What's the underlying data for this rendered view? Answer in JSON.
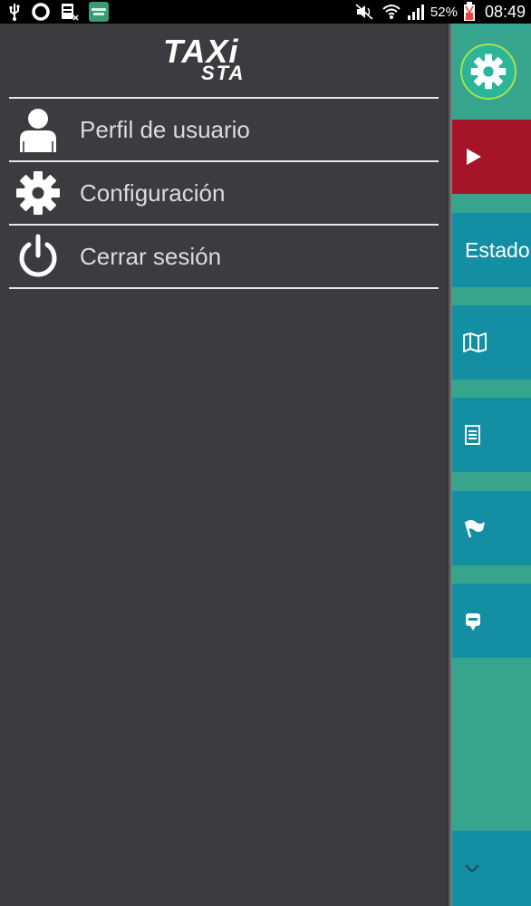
{
  "status_bar": {
    "battery_percent": "52%",
    "time": "08:49",
    "icons": [
      "usb-icon",
      "circle-icon",
      "sim-notification-icon",
      "taxista-app-icon",
      "mute-icon",
      "wifi-icon",
      "signal-icon",
      "battery-icon"
    ]
  },
  "drawer": {
    "logo": {
      "top": "TAXi",
      "bottom": "STA"
    },
    "menu": [
      {
        "label": "Perfil de usuario",
        "icon": "user-icon"
      },
      {
        "label": "Configuración",
        "icon": "gear-icon"
      },
      {
        "label": "Cerrar sesión",
        "icon": "power-icon"
      }
    ]
  },
  "rail": {
    "estado_label": "Estado",
    "items": [
      {
        "icon": "settings-gear-icon"
      },
      {
        "icon": "play-icon"
      },
      {
        "icon": "map-icon"
      },
      {
        "icon": "document-icon"
      },
      {
        "icon": "flag-icon"
      },
      {
        "icon": "taxi-icon"
      },
      {
        "icon": "chevron-down-icon"
      }
    ]
  },
  "colors": {
    "drawer_bg": "#3c3b3f",
    "rail_teal": "#37a58d",
    "rail_blue": "#138ea3",
    "rail_red": "#a51429",
    "accent_ring": "#a7e24a"
  }
}
